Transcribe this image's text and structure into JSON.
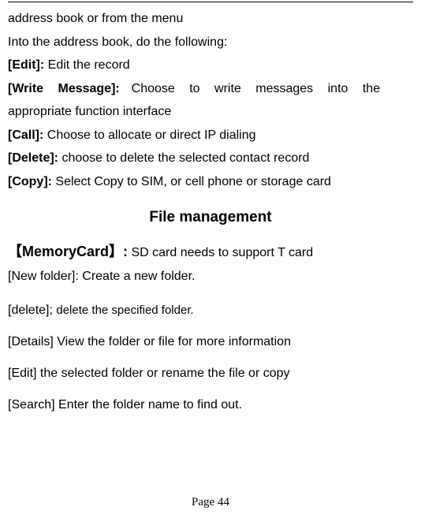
{
  "top": {
    "line1": "address book or from the menu",
    "line2": "Into the address book, do the following:",
    "edit_label": "[Edit]:",
    "edit_text": " Edit the record",
    "wm_label": "[Write Message]:",
    "wm_text_a": "Choose to write messages into the",
    "wm_text_b": "appropriate function interface",
    "call_label": "[Call]:",
    "call_text": " Choose to allocate or direct IP dialing",
    "del_label": "[Delete]:",
    "del_text": " choose to delete the selected contact record",
    "copy_label": "[Copy]:",
    "copy_text": " Select Copy to SIM, or cell phone or storage card"
  },
  "section_title": "File management",
  "fm": {
    "mem_label": "【MemoryCard】:",
    "mem_text": " SD card needs to support T card",
    "newfolder": "[New folder]: Create a new folder.",
    "delete_a": "[delete]; ",
    "delete_b": "delete the specified folder.",
    "details": "[Details] View the folder or file for more information",
    "edit": "[Edit] the selected folder or rename the file or copy",
    "search": "[Search] Enter the folder name to find out."
  },
  "page_number": "Page 44"
}
